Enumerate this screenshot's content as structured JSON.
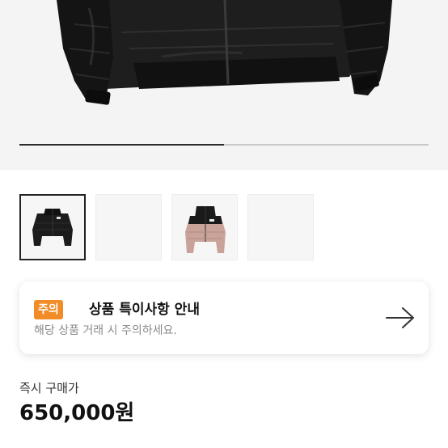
{
  "gallery": {
    "progress_fraction": 0.5,
    "current_image": "black-cropped-puffer-jacket",
    "thumbnails": [
      {
        "name": "black-puffer-jacket",
        "selected": true
      },
      {
        "name": "blank",
        "selected": false
      },
      {
        "name": "pink-puffer-jacket",
        "selected": false
      },
      {
        "name": "blank",
        "selected": false
      }
    ]
  },
  "notice": {
    "badge": "주의",
    "title": "상품 특이사항 안내",
    "subtitle": "해당 상품 거래 시 주의하세요.",
    "arrow_icon": "arrow-right-icon",
    "badge_color": "#f28c28"
  },
  "pricing": {
    "label": "즉시 구매가",
    "price": "650,000원"
  }
}
